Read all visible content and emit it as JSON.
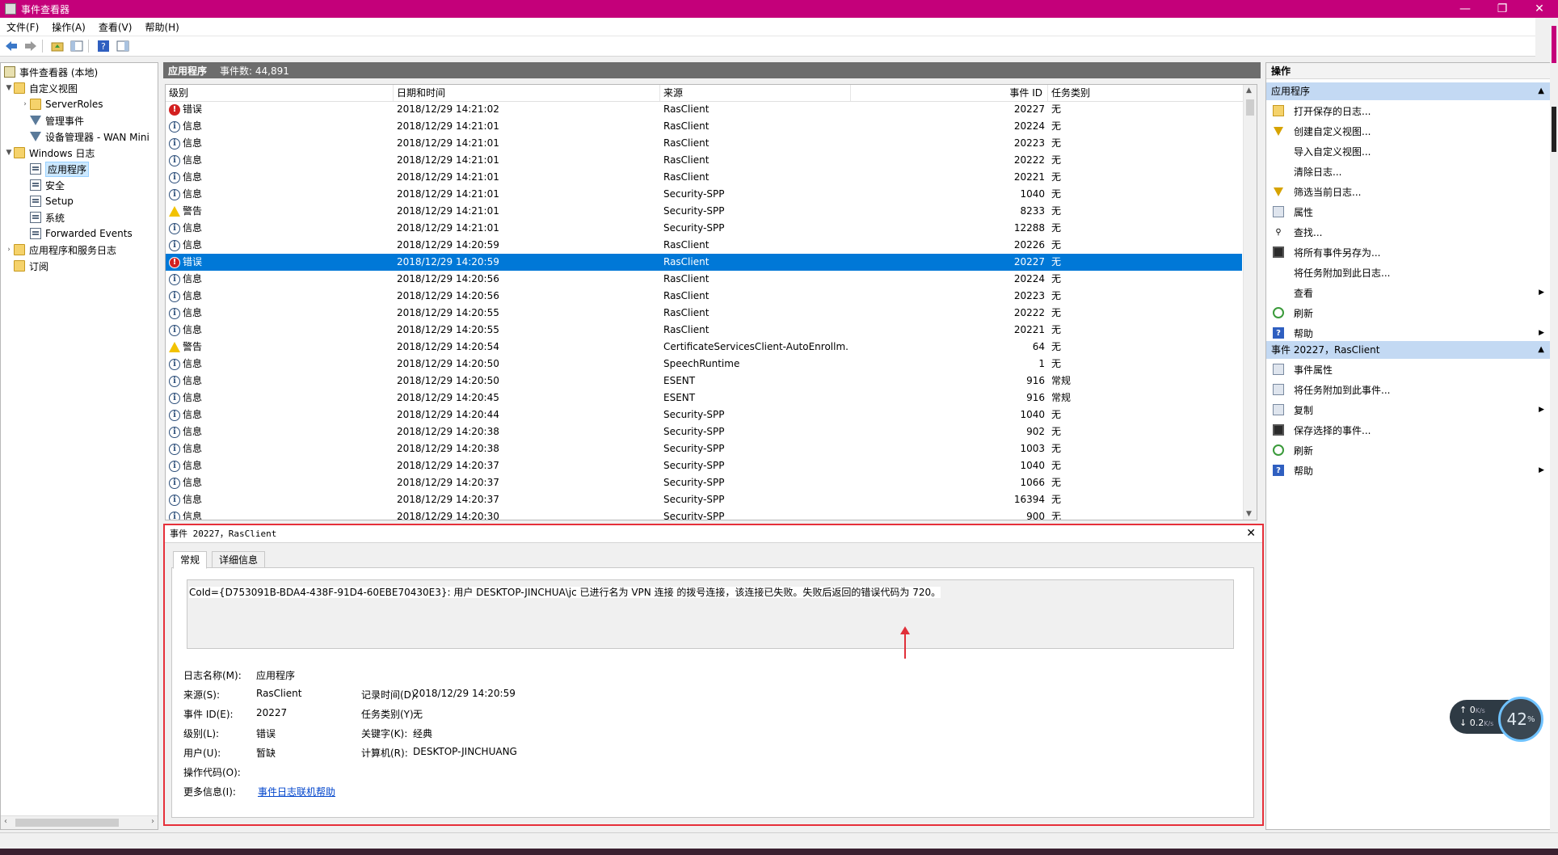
{
  "window": {
    "title": "事件查看器",
    "minimize": "—",
    "maximize": "❐",
    "close": "✕"
  },
  "menu": [
    "文件(F)",
    "操作(A)",
    "查看(V)",
    "帮助(H)"
  ],
  "tree": {
    "root": "事件查看器 (本地)",
    "custom_views": "自定义视图",
    "server_roles": "ServerRoles",
    "admin_events": "管理事件",
    "device_manager": "设备管理器 - WAN Mini",
    "windows_logs": "Windows 日志",
    "application": "应用程序",
    "security": "安全",
    "setup": "Setup",
    "system": "系统",
    "forwarded": "Forwarded Events",
    "app_service_logs": "应用程序和服务日志",
    "subscriptions": "订阅"
  },
  "center": {
    "log_name": "应用程序",
    "event_count": "事件数: 44,891"
  },
  "grid": {
    "headers": {
      "level": "级别",
      "date": "日期和时间",
      "source": "来源",
      "id": "事件 ID",
      "task": "任务类别"
    },
    "rows": [
      {
        "level": "错误",
        "type": "error",
        "date": "2018/12/29 14:21:02",
        "source": "RasClient",
        "id": "20227",
        "task": "无"
      },
      {
        "level": "信息",
        "type": "info",
        "date": "2018/12/29 14:21:01",
        "source": "RasClient",
        "id": "20224",
        "task": "无"
      },
      {
        "level": "信息",
        "type": "info",
        "date": "2018/12/29 14:21:01",
        "source": "RasClient",
        "id": "20223",
        "task": "无"
      },
      {
        "level": "信息",
        "type": "info",
        "date": "2018/12/29 14:21:01",
        "source": "RasClient",
        "id": "20222",
        "task": "无"
      },
      {
        "level": "信息",
        "type": "info",
        "date": "2018/12/29 14:21:01",
        "source": "RasClient",
        "id": "20221",
        "task": "无"
      },
      {
        "level": "信息",
        "type": "info",
        "date": "2018/12/29 14:21:01",
        "source": "Security-SPP",
        "id": "1040",
        "task": "无"
      },
      {
        "level": "警告",
        "type": "warn",
        "date": "2018/12/29 14:21:01",
        "source": "Security-SPP",
        "id": "8233",
        "task": "无"
      },
      {
        "level": "信息",
        "type": "info",
        "date": "2018/12/29 14:21:01",
        "source": "Security-SPP",
        "id": "12288",
        "task": "无"
      },
      {
        "level": "信息",
        "type": "info",
        "date": "2018/12/29 14:20:59",
        "source": "RasClient",
        "id": "20226",
        "task": "无"
      },
      {
        "level": "错误",
        "type": "error",
        "date": "2018/12/29 14:20:59",
        "source": "RasClient",
        "id": "20227",
        "task": "无",
        "selected": true
      },
      {
        "level": "信息",
        "type": "info",
        "date": "2018/12/29 14:20:56",
        "source": "RasClient",
        "id": "20224",
        "task": "无"
      },
      {
        "level": "信息",
        "type": "info",
        "date": "2018/12/29 14:20:56",
        "source": "RasClient",
        "id": "20223",
        "task": "无"
      },
      {
        "level": "信息",
        "type": "info",
        "date": "2018/12/29 14:20:55",
        "source": "RasClient",
        "id": "20222",
        "task": "无"
      },
      {
        "level": "信息",
        "type": "info",
        "date": "2018/12/29 14:20:55",
        "source": "RasClient",
        "id": "20221",
        "task": "无"
      },
      {
        "level": "警告",
        "type": "warn",
        "date": "2018/12/29 14:20:54",
        "source": "CertificateServicesClient-AutoEnrollm...",
        "id": "64",
        "task": "无"
      },
      {
        "level": "信息",
        "type": "info",
        "date": "2018/12/29 14:20:50",
        "source": "SpeechRuntime",
        "id": "1",
        "task": "无"
      },
      {
        "level": "信息",
        "type": "info",
        "date": "2018/12/29 14:20:50",
        "source": "ESENT",
        "id": "916",
        "task": "常规"
      },
      {
        "level": "信息",
        "type": "info",
        "date": "2018/12/29 14:20:45",
        "source": "ESENT",
        "id": "916",
        "task": "常规"
      },
      {
        "level": "信息",
        "type": "info",
        "date": "2018/12/29 14:20:44",
        "source": "Security-SPP",
        "id": "1040",
        "task": "无"
      },
      {
        "level": "信息",
        "type": "info",
        "date": "2018/12/29 14:20:38",
        "source": "Security-SPP",
        "id": "902",
        "task": "无"
      },
      {
        "level": "信息",
        "type": "info",
        "date": "2018/12/29 14:20:38",
        "source": "Security-SPP",
        "id": "1003",
        "task": "无"
      },
      {
        "level": "信息",
        "type": "info",
        "date": "2018/12/29 14:20:37",
        "source": "Security-SPP",
        "id": "1040",
        "task": "无"
      },
      {
        "level": "信息",
        "type": "info",
        "date": "2018/12/29 14:20:37",
        "source": "Security-SPP",
        "id": "1066",
        "task": "无"
      },
      {
        "level": "信息",
        "type": "info",
        "date": "2018/12/29 14:20:37",
        "source": "Security-SPP",
        "id": "16394",
        "task": "无"
      },
      {
        "level": "信息",
        "type": "info",
        "date": "2018/12/29 14:20:30",
        "source": "Security-SPP",
        "id": "900",
        "task": "无"
      }
    ]
  },
  "detail": {
    "header": "事件 20227，RasClient",
    "tab_general": "常规",
    "tab_details": "详细信息",
    "description": "CoId={D753091B-BDA4-438F-91D4-60EBE70430E3}: 用户 DESKTOP-JINCHUA\\jc 已进行名为 VPN 连接 的拨号连接，该连接已失败。失败后返回的错误代码为 720。",
    "labels": {
      "log_name": "日志名称(M):",
      "source": "来源(S):",
      "event_id": "事件 ID(E):",
      "level": "级别(L):",
      "user": "用户(U):",
      "opcode": "操作代码(O):",
      "more_info": "更多信息(I):",
      "logged": "记录时间(D):",
      "task": "任务类别(Y):",
      "keywords": "关键字(K):",
      "computer": "计算机(R):"
    },
    "values": {
      "log_name": "应用程序",
      "source": "RasClient",
      "event_id": "20227",
      "level": "错误",
      "user": "暂缺",
      "opcode": "",
      "more_info": "事件日志联机帮助",
      "logged": "2018/12/29 14:20:59",
      "task": "无",
      "keywords": "经典",
      "computer": "DESKTOP-JINCHUANG"
    }
  },
  "actions": {
    "title": "操作",
    "section1": "应用程序",
    "items1": [
      {
        "label": "打开保存的日志...",
        "icon": "folder-icon"
      },
      {
        "label": "创建自定义视图...",
        "icon": "filter-icon"
      },
      {
        "label": "导入自定义视图...",
        "icon": "blank"
      },
      {
        "label": "清除日志...",
        "icon": "blank"
      },
      {
        "label": "筛选当前日志...",
        "icon": "filter-icon"
      },
      {
        "label": "属性",
        "icon": "properties-icon"
      },
      {
        "label": "查找...",
        "icon": "find-icon"
      },
      {
        "label": "将所有事件另存为...",
        "icon": "save-icon"
      },
      {
        "label": "将任务附加到此日志...",
        "icon": "blank"
      },
      {
        "label": "查看",
        "icon": "blank",
        "submenu": true
      },
      {
        "label": "刷新",
        "icon": "refresh-icon"
      },
      {
        "label": "帮助",
        "icon": "help-icon",
        "submenu": true
      }
    ],
    "section2": "事件 20227，RasClient",
    "items2": [
      {
        "label": "事件属性",
        "icon": "properties-icon"
      },
      {
        "label": "将任务附加到此事件...",
        "icon": "task-icon"
      },
      {
        "label": "复制",
        "icon": "copy-icon",
        "submenu": true
      },
      {
        "label": "保存选择的事件...",
        "icon": "save-icon"
      },
      {
        "label": "刷新",
        "icon": "refresh-icon"
      },
      {
        "label": "帮助",
        "icon": "help-icon",
        "submenu": true
      }
    ]
  },
  "speed": {
    "up": "0",
    "down": "0.2",
    "unit": "K/s",
    "percent": "42",
    "percent_sign": "%"
  },
  "colors": {
    "titlebar": "#c4007a",
    "selection": "#0078d7",
    "highlight_border": "#e6303a"
  }
}
